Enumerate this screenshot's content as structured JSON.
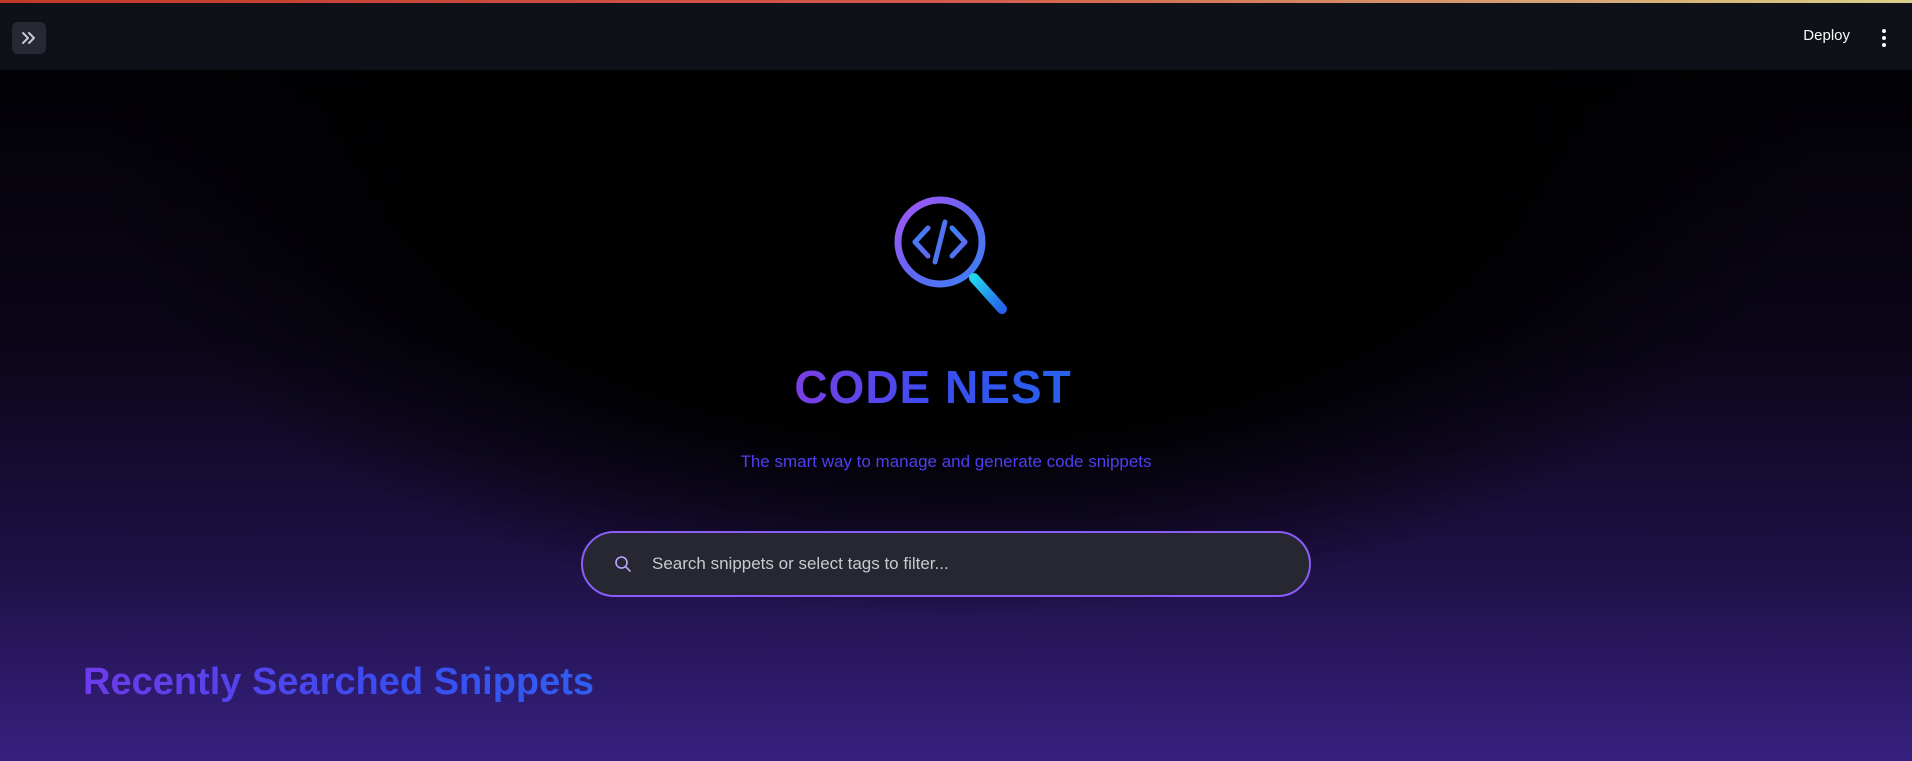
{
  "header": {
    "sidebar_toggle_icon": "double-chevron-right-icon",
    "deploy_label": "Deploy",
    "menu_icon": "vertical-ellipsis-icon"
  },
  "hero": {
    "logo_icon": "magnifier-code-icon",
    "title": "CODE NEST",
    "subtitle": "The smart way to manage and generate code snippets"
  },
  "search": {
    "icon": "search-icon",
    "placeholder": "Search snippets or select tags to filter...",
    "value": ""
  },
  "recent": {
    "heading": "Recently Searched Snippets"
  },
  "colors": {
    "accent": "#8b5cf6",
    "title_start": "#7b3fe4",
    "title_end": "#2563eb",
    "header_bg": "#0e1117"
  }
}
